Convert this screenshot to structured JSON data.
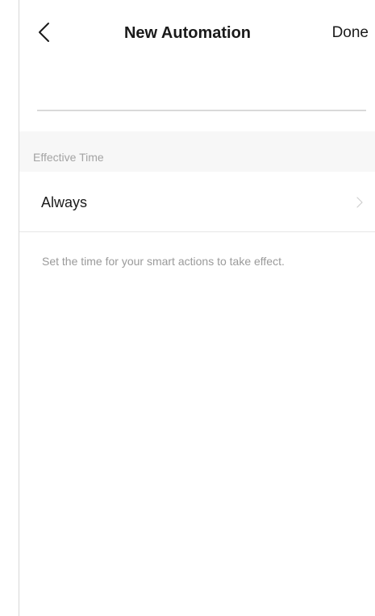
{
  "nav": {
    "title": "New Automation",
    "done_label": "Done",
    "back_icon": "chevron-left-icon"
  },
  "name_field": {
    "value": "",
    "placeholder": ""
  },
  "effective_time": {
    "section_label": "Effective Time",
    "value": "Always",
    "chevron_icon": "chevron-right-icon",
    "helper": "Set the time for your smart actions to take effect."
  },
  "colors": {
    "background": "#ffffff",
    "section_background": "#f7f7f7",
    "text_primary": "#1a1a1a",
    "text_secondary": "#a3a3a3",
    "divider": "#e6e6e6"
  }
}
